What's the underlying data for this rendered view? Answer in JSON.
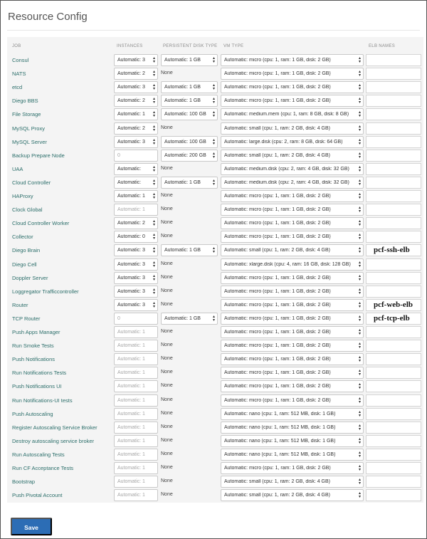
{
  "page": {
    "title": "Resource Config"
  },
  "headers": {
    "job": "JOB",
    "instances": "INSTANCES",
    "disk": "PERSISTENT DISK TYPE",
    "vm": "VM TYPE",
    "elb": "ELB NAMES"
  },
  "jobs": [
    {
      "name": "Consul",
      "instances": "Automatic: 3",
      "inst_disabled": false,
      "disk": "Automatic: 1 GB",
      "disk_select": true,
      "vm": "Automatic: micro (cpu: 1, ram: 1 GB, disk: 2 GB)",
      "elb": ""
    },
    {
      "name": "NATS",
      "instances": "Automatic: 2",
      "inst_disabled": false,
      "disk": "None",
      "disk_select": false,
      "vm": "Automatic: micro (cpu: 1, ram: 1 GB, disk: 2 GB)",
      "elb": ""
    },
    {
      "name": "etcd",
      "instances": "Automatic: 3",
      "inst_disabled": false,
      "disk": "Automatic: 1 GB",
      "disk_select": true,
      "vm": "Automatic: micro (cpu: 1, ram: 1 GB, disk: 2 GB)",
      "elb": ""
    },
    {
      "name": "Diego BBS",
      "instances": "Automatic: 2",
      "inst_disabled": false,
      "disk": "Automatic: 1 GB",
      "disk_select": true,
      "vm": "Automatic: micro (cpu: 1, ram: 1 GB, disk: 2 GB)",
      "elb": ""
    },
    {
      "name": "File Storage",
      "instances": "Automatic: 1",
      "inst_disabled": false,
      "disk": "Automatic: 100 GB",
      "disk_select": true,
      "vm": "Automatic: medium.mem (cpu: 1, ram: 8 GB, disk: 8 GB)",
      "elb": ""
    },
    {
      "name": "MySQL Proxy",
      "instances": "Automatic: 2",
      "inst_disabled": false,
      "disk": "None",
      "disk_select": false,
      "vm": "Automatic: small (cpu: 1, ram: 2 GB, disk: 4 GB)",
      "elb": ""
    },
    {
      "name": "MySQL Server",
      "instances": "Automatic: 3",
      "inst_disabled": false,
      "disk": "Automatic: 100 GB",
      "disk_select": true,
      "vm": "Automatic: large.disk (cpu: 2, ram: 8 GB, disk: 64 GB)",
      "elb": ""
    },
    {
      "name": "Backup Prepare Node",
      "instances": "0",
      "inst_disabled": true,
      "disk": "Automatic: 200 GB",
      "disk_select": true,
      "vm": "Automatic: small (cpu: 1, ram: 2 GB, disk: 4 GB)",
      "elb": ""
    },
    {
      "name": "UAA",
      "instances": "Automatic:",
      "inst_disabled": false,
      "disk": "None",
      "disk_select": false,
      "vm": "Automatic: medium.disk (cpu: 2, ram: 4 GB, disk: 32 GB)",
      "elb": ""
    },
    {
      "name": "Cloud Controller",
      "instances": "Automatic:",
      "inst_disabled": false,
      "disk": "Automatic: 1 GB",
      "disk_select": true,
      "vm": "Automatic: medium.disk (cpu: 2, ram: 4 GB, disk: 32 GB)",
      "elb": ""
    },
    {
      "name": "HAProxy",
      "instances": "Automatic: 1",
      "inst_disabled": false,
      "disk": "None",
      "disk_select": false,
      "vm": "Automatic: micro (cpu: 1, ram: 1 GB, disk: 2 GB)",
      "elb": ""
    },
    {
      "name": "Clock Global",
      "instances": "Automatic: 1",
      "inst_disabled": true,
      "disk": "None",
      "disk_select": false,
      "vm": "Automatic: micro (cpu: 1, ram: 1 GB, disk: 2 GB)",
      "elb": ""
    },
    {
      "name": "Cloud Controller Worker",
      "instances": "Automatic: 2",
      "inst_disabled": false,
      "disk": "None",
      "disk_select": false,
      "vm": "Automatic: micro (cpu: 1, ram: 1 GB, disk: 2 GB)",
      "elb": ""
    },
    {
      "name": "Collector",
      "instances": "Automatic: 0",
      "inst_disabled": false,
      "disk": "None",
      "disk_select": false,
      "vm": "Automatic: micro (cpu: 1, ram: 1 GB, disk: 2 GB)",
      "elb": ""
    },
    {
      "name": "Diego Brain",
      "instances": "Automatic: 3",
      "inst_disabled": false,
      "disk": "Automatic: 1 GB",
      "disk_select": true,
      "vm": "Automatic: small (cpu: 1, ram: 2 GB, disk: 4 GB)",
      "elb": "pcf-ssh-elb"
    },
    {
      "name": "Diego Cell",
      "instances": "Automatic: 3",
      "inst_disabled": false,
      "disk": "None",
      "disk_select": false,
      "vm": "Automatic: xlarge.disk (cpu: 4, ram: 16 GB, disk: 128 GB)",
      "elb": ""
    },
    {
      "name": "Doppler Server",
      "instances": "Automatic: 3",
      "inst_disabled": false,
      "disk": "None",
      "disk_select": false,
      "vm": "Automatic: micro (cpu: 1, ram: 1 GB, disk: 2 GB)",
      "elb": ""
    },
    {
      "name": "Loggregator Trafficcontroller",
      "instances": "Automatic: 3",
      "inst_disabled": false,
      "disk": "None",
      "disk_select": false,
      "vm": "Automatic: micro (cpu: 1, ram: 1 GB, disk: 2 GB)",
      "elb": ""
    },
    {
      "name": "Router",
      "instances": "Automatic: 3",
      "inst_disabled": false,
      "disk": "None",
      "disk_select": false,
      "vm": "Automatic: micro (cpu: 1, ram: 1 GB, disk: 2 GB)",
      "elb": "pcf-web-elb"
    },
    {
      "name": "TCP Router",
      "instances": "0",
      "inst_disabled": true,
      "disk": "Automatic: 1 GB",
      "disk_select": true,
      "vm": "Automatic: micro (cpu: 1, ram: 1 GB, disk: 2 GB)",
      "elb": "pcf-tcp-elb"
    },
    {
      "name": "Push Apps Manager",
      "instances": "Automatic: 1",
      "inst_disabled": true,
      "disk": "None",
      "disk_select": false,
      "vm": "Automatic: micro (cpu: 1, ram: 1 GB, disk: 2 GB)",
      "elb": ""
    },
    {
      "name": "Run Smoke Tests",
      "instances": "Automatic: 1",
      "inst_disabled": true,
      "disk": "None",
      "disk_select": false,
      "vm": "Automatic: micro (cpu: 1, ram: 1 GB, disk: 2 GB)",
      "elb": ""
    },
    {
      "name": "Push Notifications",
      "instances": "Automatic: 1",
      "inst_disabled": true,
      "disk": "None",
      "disk_select": false,
      "vm": "Automatic: micro (cpu: 1, ram: 1 GB, disk: 2 GB)",
      "elb": ""
    },
    {
      "name": "Run Notifications Tests",
      "instances": "Automatic: 1",
      "inst_disabled": true,
      "disk": "None",
      "disk_select": false,
      "vm": "Automatic: micro (cpu: 1, ram: 1 GB, disk: 2 GB)",
      "elb": ""
    },
    {
      "name": "Push Notifications UI",
      "instances": "Automatic: 1",
      "inst_disabled": true,
      "disk": "None",
      "disk_select": false,
      "vm": "Automatic: micro (cpu: 1, ram: 1 GB, disk: 2 GB)",
      "elb": ""
    },
    {
      "name": "Run Notifications-UI tests",
      "instances": "Automatic: 1",
      "inst_disabled": true,
      "disk": "None",
      "disk_select": false,
      "vm": "Automatic: micro (cpu: 1, ram: 1 GB, disk: 2 GB)",
      "elb": ""
    },
    {
      "name": "Push Autoscaling",
      "instances": "Automatic: 1",
      "inst_disabled": true,
      "disk": "None",
      "disk_select": false,
      "vm": "Automatic: nano (cpu: 1, ram: 512 MB, disk: 1 GB)",
      "elb": ""
    },
    {
      "name": "Register Autoscaling Service Broker",
      "instances": "Automatic: 1",
      "inst_disabled": true,
      "disk": "None",
      "disk_select": false,
      "vm": "Automatic: nano (cpu: 1, ram: 512 MB, disk: 1 GB)",
      "elb": ""
    },
    {
      "name": "Destroy autoscaling service broker",
      "instances": "Automatic: 1",
      "inst_disabled": true,
      "disk": "None",
      "disk_select": false,
      "vm": "Automatic: nano (cpu: 1, ram: 512 MB, disk: 1 GB)",
      "elb": ""
    },
    {
      "name": "Run Autoscaling Tests",
      "instances": "Automatic: 1",
      "inst_disabled": true,
      "disk": "None",
      "disk_select": false,
      "vm": "Automatic: nano (cpu: 1, ram: 512 MB, disk: 1 GB)",
      "elb": ""
    },
    {
      "name": "Run CF Acceptance Tests",
      "instances": "Automatic: 1",
      "inst_disabled": true,
      "disk": "None",
      "disk_select": false,
      "vm": "Automatic: micro (cpu: 1, ram: 1 GB, disk: 2 GB)",
      "elb": ""
    },
    {
      "name": "Bootstrap",
      "instances": "Automatic: 1",
      "inst_disabled": true,
      "disk": "None",
      "disk_select": false,
      "vm": "Automatic: small (cpu: 1, ram: 2 GB, disk: 4 GB)",
      "elb": ""
    },
    {
      "name": "Push Pivotal Account",
      "instances": "Automatic: 1",
      "inst_disabled": true,
      "disk": "None",
      "disk_select": false,
      "vm": "Automatic: small (cpu: 1, ram: 2 GB, disk: 4 GB)",
      "elb": ""
    }
  ],
  "save_label": "Save"
}
